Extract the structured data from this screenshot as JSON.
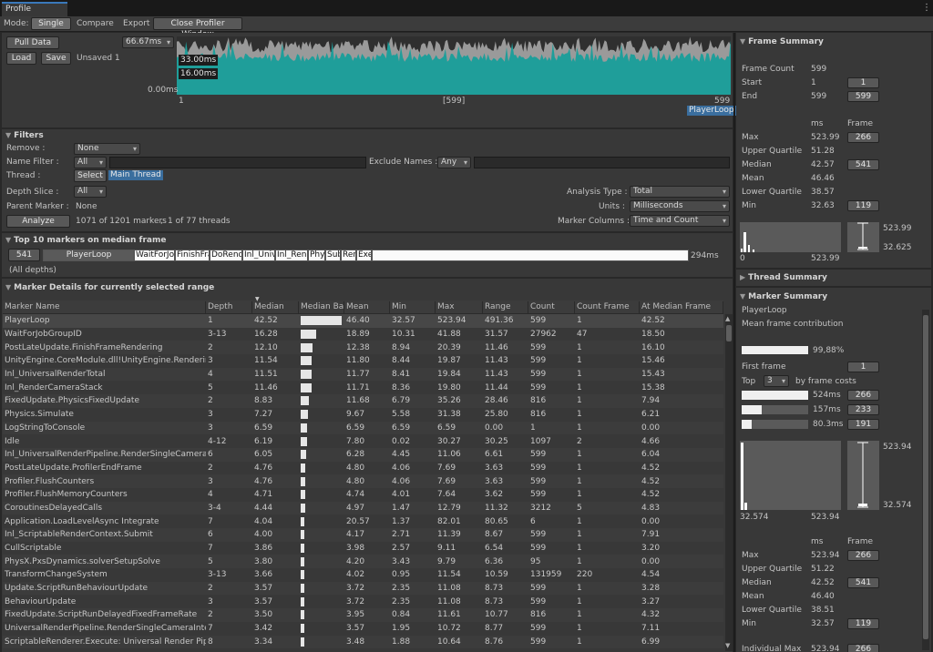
{
  "window": {
    "tab_title": "Profile Analyzer"
  },
  "toolbar": {
    "mode_label": "Mode:",
    "single": "Single",
    "compare": "Compare",
    "export": "Export",
    "close": "Close Profiler Window"
  },
  "top_controls": {
    "pull_data": "Pull Data",
    "load": "Load",
    "save": "Save",
    "unsaved": "Unsaved 1",
    "range_value": "66.67ms"
  },
  "frame_graph": {
    "label_33": "33.00ms",
    "label_16": "16.00ms",
    "label_0": "0.00ms",
    "x_start": "1",
    "x_mid": "[599]",
    "x_end": "599",
    "selected_marker": "PlayerLoop"
  },
  "filters": {
    "title": "Filters",
    "remove_label": "Remove :",
    "remove_value": "None",
    "name_filter_label": "Name Filter :",
    "name_filter_value": "All",
    "exclude_names_label": "Exclude Names :",
    "exclude_names_value": "Any",
    "thread_label": "Thread :",
    "thread_select": "Select",
    "thread_value": "Main Thread",
    "depth_slice_label": "Depth Slice :",
    "depth_slice_value": "All",
    "parent_marker_label": "Parent Marker :",
    "parent_marker_value": "None",
    "analyze": "Analyze",
    "markers_info": "1071 of 1201 markers",
    "comma": ",",
    "threads_info": "1 of 77 threads",
    "analysis_type_label": "Analysis Type :",
    "analysis_type_value": "Total",
    "units_label": "Units :",
    "units_value": "Milliseconds",
    "marker_columns_label": "Marker Columns :",
    "marker_columns_value": "Time and Count"
  },
  "top10": {
    "title": "Top 10 markers on median frame",
    "frame": "541",
    "segments": [
      "PlayerLoop",
      "WaitForJobGroupID",
      "FinishFrameRendering",
      "DoRenderLoop",
      "Inl_UniversalRenderTotal",
      "Inl_RenderCameraStack",
      "PhysicsFixedUpdate",
      "Subsystems",
      "RenderCameras",
      "ExecuteTasks"
    ],
    "segment_labels": [
      "PlayerLoop",
      "WaitForJo",
      "FinishFra",
      "DoRend",
      "Inl_Unive",
      "Inl_Rend",
      "Phy",
      "Sub",
      "Ren",
      "Exe"
    ],
    "total": "294ms",
    "depths": "(All depths)"
  },
  "marker_details": {
    "title": "Marker Details for currently selected range",
    "columns": [
      "Marker Name",
      "Depth",
      "Median",
      "Median Bar",
      "Mean",
      "Min",
      "Max",
      "Range",
      "Count",
      "Count Frame",
      "At Median Frame"
    ],
    "rows": [
      [
        "PlayerLoop",
        "1",
        "42.52",
        42.52,
        "46.40",
        "32.57",
        "523.94",
        "491.36",
        "599",
        "1",
        "42.52"
      ],
      [
        "WaitForJobGroupID",
        "3-13",
        "16.28",
        16.28,
        "18.89",
        "10.31",
        "41.88",
        "31.57",
        "27962",
        "47",
        "18.50"
      ],
      [
        "PostLateUpdate.FinishFrameRendering",
        "2",
        "12.10",
        12.1,
        "12.38",
        "8.94",
        "20.39",
        "11.46",
        "599",
        "1",
        "16.10"
      ],
      [
        "UnityEngine.CoreModule.dll!UnityEngine.Rendering::",
        "3",
        "11.54",
        11.54,
        "11.80",
        "8.44",
        "19.87",
        "11.43",
        "599",
        "1",
        "15.46"
      ],
      [
        "Inl_UniversalRenderTotal",
        "4",
        "11.51",
        11.51,
        "11.77",
        "8.41",
        "19.84",
        "11.43",
        "599",
        "1",
        "15.43"
      ],
      [
        "Inl_RenderCameraStack",
        "5",
        "11.46",
        11.46,
        "11.71",
        "8.36",
        "19.80",
        "11.44",
        "599",
        "1",
        "15.38"
      ],
      [
        "FixedUpdate.PhysicsFixedUpdate",
        "2",
        "8.83",
        8.83,
        "11.68",
        "6.79",
        "35.26",
        "28.46",
        "816",
        "1",
        "7.94"
      ],
      [
        "Physics.Simulate",
        "3",
        "7.27",
        7.27,
        "9.67",
        "5.58",
        "31.38",
        "25.80",
        "816",
        "1",
        "6.21"
      ],
      [
        "LogStringToConsole",
        "3",
        "6.59",
        6.59,
        "6.59",
        "6.59",
        "6.59",
        "0.00",
        "1",
        "1",
        "0.00"
      ],
      [
        "Idle",
        "4-12",
        "6.19",
        6.19,
        "7.80",
        "0.02",
        "30.27",
        "30.25",
        "1097",
        "2",
        "4.66"
      ],
      [
        "Inl_UniversalRenderPipeline.RenderSingleCameraInte",
        "6",
        "6.05",
        6.05,
        "6.28",
        "4.45",
        "11.06",
        "6.61",
        "599",
        "1",
        "6.04"
      ],
      [
        "PostLateUpdate.ProfilerEndFrame",
        "2",
        "4.76",
        4.76,
        "4.80",
        "4.06",
        "7.69",
        "3.63",
        "599",
        "1",
        "4.52"
      ],
      [
        "Profiler.FlushCounters",
        "3",
        "4.76",
        4.76,
        "4.80",
        "4.06",
        "7.69",
        "3.63",
        "599",
        "1",
        "4.52"
      ],
      [
        "Profiler.FlushMemoryCounters",
        "4",
        "4.71",
        4.71,
        "4.74",
        "4.01",
        "7.64",
        "3.62",
        "599",
        "1",
        "4.52"
      ],
      [
        "CoroutinesDelayedCalls",
        "3-4",
        "4.44",
        4.44,
        "4.97",
        "1.47",
        "12.79",
        "11.32",
        "3212",
        "5",
        "4.83"
      ],
      [
        "Application.LoadLevelAsync Integrate",
        "7",
        "4.04",
        4.04,
        "20.57",
        "1.37",
        "82.01",
        "80.65",
        "6",
        "1",
        "0.00"
      ],
      [
        "Inl_ScriptableRenderContext.Submit",
        "6",
        "4.00",
        4.0,
        "4.17",
        "2.71",
        "11.39",
        "8.67",
        "599",
        "1",
        "7.91"
      ],
      [
        "CullScriptable",
        "7",
        "3.86",
        3.86,
        "3.98",
        "2.57",
        "9.11",
        "6.54",
        "599",
        "1",
        "3.20"
      ],
      [
        "PhysX.PxsDynamics.solverSetupSolve",
        "5",
        "3.80",
        3.8,
        "4.20",
        "3.43",
        "9.79",
        "6.36",
        "95",
        "1",
        "0.00"
      ],
      [
        "TransformChangeSystem",
        "3-13",
        "3.66",
        3.66,
        "4.02",
        "0.95",
        "11.54",
        "10.59",
        "131959",
        "220",
        "4.54"
      ],
      [
        "Update.ScriptRunBehaviourUpdate",
        "2",
        "3.57",
        3.57,
        "3.72",
        "2.35",
        "11.08",
        "8.73",
        "599",
        "1",
        "3.28"
      ],
      [
        "BehaviourUpdate",
        "3",
        "3.57",
        3.57,
        "3.72",
        "2.35",
        "11.08",
        "8.73",
        "599",
        "1",
        "3.27"
      ],
      [
        "FixedUpdate.ScriptRunDelayedFixedFrameRate",
        "2",
        "3.50",
        3.5,
        "3.95",
        "0.84",
        "11.61",
        "10.77",
        "816",
        "1",
        "4.32"
      ],
      [
        "UniversalRenderPipeline.RenderSingleCameraInterna",
        "7",
        "3.42",
        3.42,
        "3.57",
        "1.95",
        "10.72",
        "8.77",
        "599",
        "1",
        "7.11"
      ],
      [
        "ScriptableRenderer.Execute: Universal Render Pipeli",
        "8",
        "3.34",
        3.34,
        "3.48",
        "1.88",
        "10.64",
        "8.76",
        "599",
        "1",
        "6.99"
      ]
    ]
  },
  "frame_summary": {
    "title": "Frame Summary",
    "frame_count_label": "Frame Count",
    "frame_count": "599",
    "start_label": "Start",
    "start": "1",
    "start_btn": "1",
    "end_label": "End",
    "end": "599",
    "end_btn": "599",
    "col_ms": "ms",
    "col_frame": "Frame",
    "stats": [
      {
        "label": "Max",
        "ms": "523.99",
        "frame": "266"
      },
      {
        "label": "Upper Quartile",
        "ms": "51.28",
        "frame": ""
      },
      {
        "label": "Median",
        "ms": "42.57",
        "frame": "541"
      },
      {
        "label": "Mean",
        "ms": "46.46",
        "frame": ""
      },
      {
        "label": "Lower Quartile",
        "ms": "38.57",
        "frame": ""
      },
      {
        "label": "Min",
        "ms": "32.63",
        "frame": "119"
      }
    ],
    "hist_min": "0",
    "hist_max": "523.99",
    "box_max": "523.99",
    "box_min": "32.625"
  },
  "thread_summary": {
    "title": "Thread Summary"
  },
  "marker_summary": {
    "title": "Marker Summary",
    "marker": "PlayerLoop",
    "contribution_label": "Mean frame contribution",
    "contribution_pct": 0.9988,
    "contribution": "99,88%",
    "first_frame_label": "First frame",
    "first_frame": "1",
    "top_label": "Top",
    "top_value": "3",
    "top_suffix": "by frame costs",
    "top_frames": [
      {
        "ms": "524ms",
        "frame": "266",
        "fill": 1.0
      },
      {
        "ms": "157ms",
        "frame": "233",
        "fill": 0.3
      },
      {
        "ms": "80.3ms",
        "frame": "191",
        "fill": 0.15
      }
    ],
    "hist_min": "32.574",
    "hist_max": "523.94",
    "box_max": "523.94",
    "box_min": "32.574",
    "col_ms": "ms",
    "col_frame": "Frame",
    "stats": [
      {
        "label": "Max",
        "ms": "523.94",
        "frame": "266"
      },
      {
        "label": "Upper Quartile",
        "ms": "51.22",
        "frame": ""
      },
      {
        "label": "Median",
        "ms": "42.52",
        "frame": "541"
      },
      {
        "label": "Mean",
        "ms": "46.40",
        "frame": ""
      },
      {
        "label": "Lower Quartile",
        "ms": "38.51",
        "frame": ""
      },
      {
        "label": "Min",
        "ms": "32.57",
        "frame": "119"
      }
    ],
    "individual_max_label": "Individual Max",
    "individual_max": "523.94",
    "individual_max_frame": "266"
  },
  "colors": {
    "graph_teal": "#1f9e9a",
    "graph_top": "#9a9a9a",
    "selection_blue": "#3a6e9e",
    "window_bg": "#282828"
  }
}
